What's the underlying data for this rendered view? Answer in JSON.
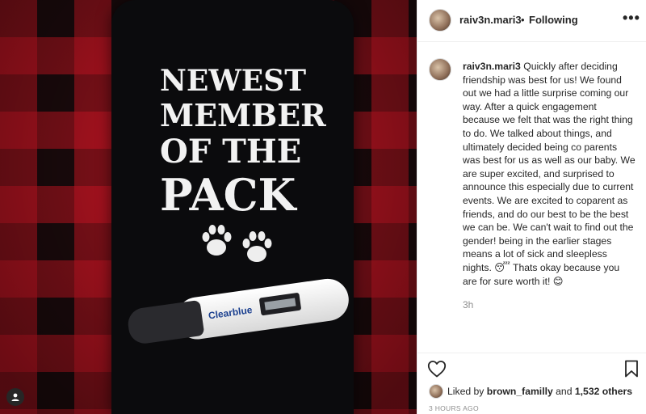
{
  "photo": {
    "shirt_lines": [
      "NEWEST",
      "MEMBER",
      "OF THE",
      "PACK"
    ],
    "test_brand": "Clearblue",
    "colors": {
      "plaid_red": "#c81423",
      "plaid_black": "#1a0a0c",
      "shirt": "#0b0b0d"
    }
  },
  "header": {
    "username": "raiv3n.mari3",
    "separator": "•",
    "follow_status": "Following",
    "more_icon": "more-horizontal-icon"
  },
  "caption": {
    "username": "raiv3n.mari3",
    "text": "Quickly after deciding friendship was best for us! We found out we had a little surprise coming our way. After a quick engagement because we felt that was the right thing to do. We talked about things, and ultimately decided being co parents was best for us as well as our baby. We are super excited, and surprised to announce this especially due to current events. We are excited to coparent as friends, and do our best to be the best we can be. We can't wait to find out the gender! being in the earlier stages means a lot of sick and sleepless nights. 😴 Thats okay because you are for sure worth it! 😊",
    "time": "3h"
  },
  "actions": {
    "heart_icon": "heart-icon",
    "bookmark_icon": "bookmark-icon",
    "liked_prefix": "Liked by",
    "liked_user": "brown_familly",
    "liked_and": "and",
    "liked_others": "1,532 others",
    "posted": "3 HOURS AGO"
  }
}
